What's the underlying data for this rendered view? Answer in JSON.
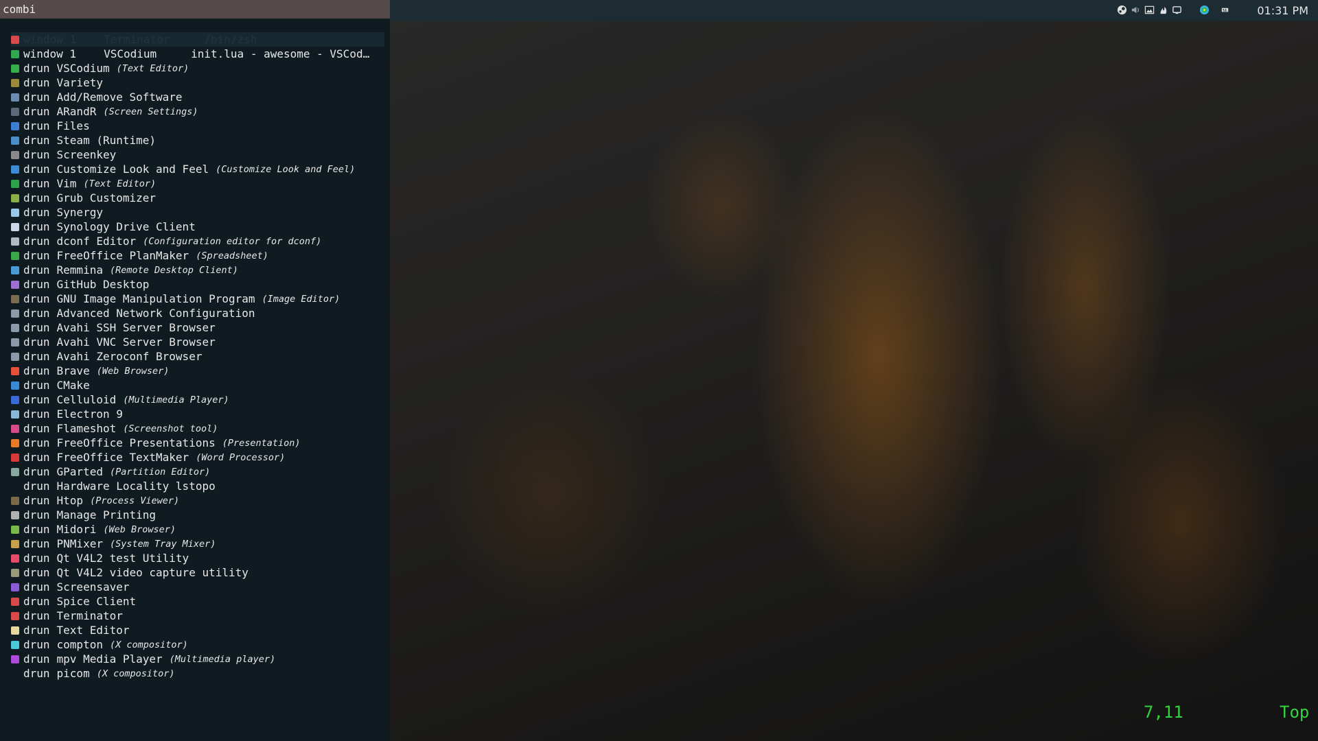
{
  "launcher": {
    "prompt": "combi",
    "entries": [
      {
        "mode": "window 1",
        "name": "Terminator",
        "extra": "/bin/zsh",
        "icon_color": "#d94a4a",
        "selected": true
      },
      {
        "mode": "window 1",
        "name": "VSCodium",
        "extra": "init.lua - awesome - VSCod…",
        "icon_color": "#2fa84f"
      },
      {
        "mode": "drun",
        "name": "VSCodium",
        "desc": "(Text Editor)",
        "icon_color": "#35b04a"
      },
      {
        "mode": "drun",
        "name": "Variety",
        "icon_color": "#9a8a3a"
      },
      {
        "mode": "drun",
        "name": "Add/Remove Software",
        "icon_color": "#6d8bb0"
      },
      {
        "mode": "drun",
        "name": "ARandR",
        "desc": "(Screen Settings)",
        "icon_color": "#5b6a78"
      },
      {
        "mode": "drun",
        "name": "Files",
        "icon_color": "#3b7fd4"
      },
      {
        "mode": "drun",
        "name": "Steam (Runtime)",
        "icon_color": "#4a8ec8"
      },
      {
        "mode": "drun",
        "name": "Screenkey",
        "icon_color": "#8a8a8a"
      },
      {
        "mode": "drun",
        "name": "Customize Look and Feel",
        "desc": "(Customize Look and Feel)",
        "icon_color": "#3d8ad6"
      },
      {
        "mode": "drun",
        "name": "Vim",
        "desc": "(Text Editor)",
        "icon_color": "#2ea44a"
      },
      {
        "mode": "drun",
        "name": "Grub Customizer",
        "icon_color": "#8ab04a"
      },
      {
        "mode": "drun",
        "name": "Synergy",
        "icon_color": "#9ac8e8"
      },
      {
        "mode": "drun",
        "name": "Synology Drive Client",
        "icon_color": "#c8d8e8"
      },
      {
        "mode": "drun",
        "name": "dconf Editor",
        "desc": "(Configuration editor for dconf)",
        "icon_color": "#b0b8c0"
      },
      {
        "mode": "drun",
        "name": "FreeOffice PlanMaker",
        "desc": "(Spreadsheet)",
        "icon_color": "#3aa84a"
      },
      {
        "mode": "drun",
        "name": "Remmina",
        "desc": "(Remote Desktop Client)",
        "icon_color": "#4a9ad8"
      },
      {
        "mode": "drun",
        "name": "GitHub Desktop",
        "icon_color": "#a070d0"
      },
      {
        "mode": "drun",
        "name": "GNU Image Manipulation Program",
        "desc": "(Image Editor)",
        "icon_color": "#7a6a50"
      },
      {
        "mode": "drun",
        "name": "Advanced Network Configuration",
        "icon_color": "#8a9aa8"
      },
      {
        "mode": "drun",
        "name": "Avahi SSH Server Browser",
        "icon_color": "#8a9aa8"
      },
      {
        "mode": "drun",
        "name": "Avahi VNC Server Browser",
        "icon_color": "#8a9aa8"
      },
      {
        "mode": "drun",
        "name": "Avahi Zeroconf Browser",
        "icon_color": "#8a9aa8"
      },
      {
        "mode": "drun",
        "name": "Brave",
        "desc": "(Web Browser)",
        "icon_color": "#e8503a"
      },
      {
        "mode": "drun",
        "name": "CMake",
        "icon_color": "#3a8ad8"
      },
      {
        "mode": "drun",
        "name": "Celluloid",
        "desc": "(Multimedia Player)",
        "icon_color": "#3a6ad8"
      },
      {
        "mode": "drun",
        "name": "Electron 9",
        "icon_color": "#8ab8d8"
      },
      {
        "mode": "drun",
        "name": "Flameshot",
        "desc": "(Screenshot tool)",
        "icon_color": "#d84a8a"
      },
      {
        "mode": "drun",
        "name": "FreeOffice Presentations",
        "desc": "(Presentation)",
        "icon_color": "#e87a2a"
      },
      {
        "mode": "drun",
        "name": "FreeOffice TextMaker",
        "desc": "(Word Processor)",
        "icon_color": "#d83a3a"
      },
      {
        "mode": "drun",
        "name": "GParted",
        "desc": "(Partition Editor)",
        "icon_color": "#8aa8a0"
      },
      {
        "mode": "drun",
        "name": "Hardware Locality lstopo",
        "icon_color": "#0f1b20"
      },
      {
        "mode": "drun",
        "name": "Htop",
        "desc": "(Process Viewer)",
        "icon_color": "#7a6a4a"
      },
      {
        "mode": "drun",
        "name": "Manage Printing",
        "icon_color": "#b0b0b0"
      },
      {
        "mode": "drun",
        "name": "Midori",
        "desc": "(Web Browser)",
        "icon_color": "#7ab84a"
      },
      {
        "mode": "drun",
        "name": "PNMixer",
        "desc": "(System Tray Mixer)",
        "icon_color": "#c8a04a"
      },
      {
        "mode": "drun",
        "name": "Qt V4L2 test Utility",
        "icon_color": "#e84a6a"
      },
      {
        "mode": "drun",
        "name": "Qt V4L2 video capture utility",
        "icon_color": "#9a9a7a"
      },
      {
        "mode": "drun",
        "name": "Screensaver",
        "icon_color": "#8a5ad8"
      },
      {
        "mode": "drun",
        "name": "Spice Client",
        "icon_color": "#d84a4a"
      },
      {
        "mode": "drun",
        "name": "Terminator",
        "icon_color": "#d84a4a"
      },
      {
        "mode": "drun",
        "name": "Text Editor",
        "icon_color": "#e8d8a0"
      },
      {
        "mode": "drun",
        "name": "compton",
        "desc": "(X compositor)",
        "icon_color": "#4ac8d8"
      },
      {
        "mode": "drun",
        "name": "mpv Media Player",
        "desc": "(Multimedia player)",
        "icon_color": "#b04ad8"
      },
      {
        "mode": "drun",
        "name": "picom",
        "desc": "(X compositor)",
        "icon_color": "#0f1b20"
      }
    ]
  },
  "topbar": {
    "clock": "01:31 PM",
    "tray_icons": [
      "steam-icon",
      "volume-icon",
      "image-icon",
      "flameshot-icon",
      "display-icon",
      "moon-icon",
      "synergy-icon",
      "keyboard-icon"
    ]
  },
  "status": {
    "position": "7,11",
    "scroll": "Top",
    "color": "#33d33d"
  }
}
